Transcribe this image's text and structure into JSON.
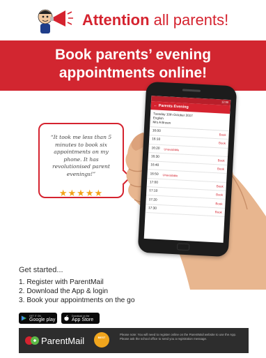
{
  "header": {
    "headline_strong": "Attention",
    "headline_light": "all parents!",
    "mascot_icon": "megaphone-mascot-icon"
  },
  "banner": {
    "line1": "Book parents’ evening",
    "line2": "appointments online!"
  },
  "testimonial": {
    "quote": "“It took me less than 5 minutes to book six appointments on my phone. It has revolutionised parent evenings!”",
    "stars": "★★★★★"
  },
  "phone": {
    "status_time": "12:00",
    "title": "← Parents Evening",
    "date": "Tuesday 10th October 2017",
    "subject": "English",
    "teacher": "Mrs A Brown",
    "slots": [
      {
        "time": "16:00",
        "status": "",
        "action": "Book"
      },
      {
        "time": "16:10",
        "status": "",
        "action": "Book"
      },
      {
        "time": "16:20",
        "status": "Unavailable",
        "action": ""
      },
      {
        "time": "16:30",
        "status": "",
        "action": "Book"
      },
      {
        "time": "16:40",
        "status": "",
        "action": "Book"
      },
      {
        "time": "16:50",
        "status": "Unavailable",
        "action": ""
      },
      {
        "time": "17:00",
        "status": "",
        "action": "Book"
      },
      {
        "time": "17:10",
        "status": "",
        "action": "Book"
      },
      {
        "time": "17:20",
        "status": "",
        "action": "Book"
      },
      {
        "time": "17:30",
        "status": "",
        "action": "Book"
      }
    ]
  },
  "steps": {
    "heading": "Get started...",
    "items": [
      "1. Register with ParentMail",
      "2. Download the App & login",
      "3. Book your appointments on the go"
    ]
  },
  "badges": {
    "google_small": "GET IT ON",
    "google_big": "Google play",
    "apple_small": "Download on the",
    "apple_big": "App Store"
  },
  "footer": {
    "brand": "ParentMail",
    "award": "BEST",
    "note": "Please note: You will need to register online on the ParentMail website to use the App. Please ask the school office to send you a registration message."
  },
  "colors": {
    "brand_red": "#d5232f",
    "star_gold": "#f2a31b",
    "footer_bg": "#2d2d2d"
  }
}
